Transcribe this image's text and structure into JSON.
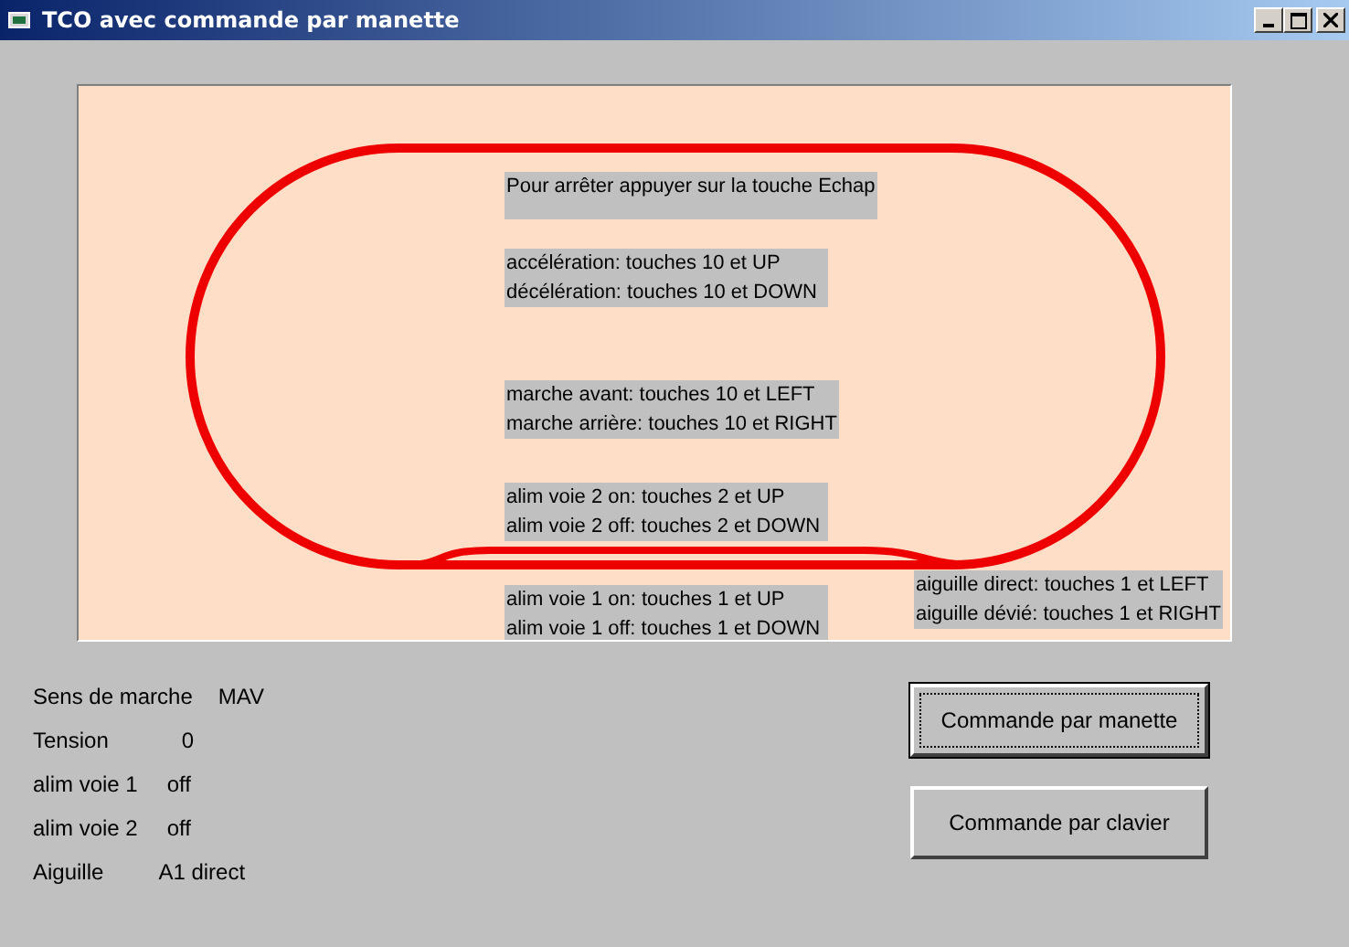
{
  "window": {
    "title": "TCO avec commande par manette"
  },
  "canvas_labels": [
    {
      "lines": [
        "Pour arrêter appuyer sur la touche Echap"
      ]
    },
    {
      "lines": [
        "accélération: touches 10 et UP",
        "décélération: touches 10 et DOWN"
      ]
    },
    {
      "lines": [
        "marche avant: touches 10 et LEFT",
        "marche arrière: touches 10 et RIGHT"
      ]
    },
    {
      "lines": [
        "alim voie 2 on: touches 2 et UP",
        "alim voie 2 off: touches 2 et DOWN"
      ]
    },
    {
      "lines": [
        "alim voie 1 on: touches 1 et UP",
        "alim voie 1 off: touches 1 et DOWN"
      ]
    },
    {
      "lines": [
        "aiguille direct: touches 1 et LEFT",
        "aiguille dévié: touches 1 et RIGHT"
      ]
    }
  ],
  "status": [
    {
      "label": "Sens de marche",
      "value": "MAV"
    },
    {
      "label": "Tension",
      "value": "0"
    },
    {
      "label": "alim voie 1",
      "value": "off"
    },
    {
      "label": "alim voie 2",
      "value": "off"
    },
    {
      "label": "Aiguille",
      "value": "A1 direct"
    }
  ],
  "buttons": [
    {
      "label": "Commande par manette",
      "focused": true
    },
    {
      "label": "Commande par clavier",
      "focused": false
    }
  ]
}
